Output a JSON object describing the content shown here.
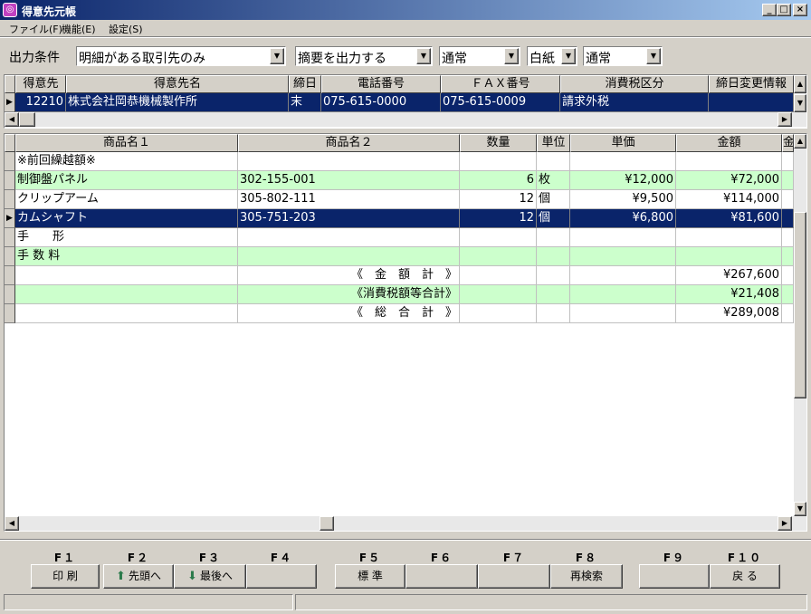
{
  "window": {
    "title": "得意先元帳",
    "icon_text": "◎",
    "minimize_label": "_",
    "maximize_label": "□",
    "close_label": "×"
  },
  "menu": {
    "items": [
      "ファイル(F)",
      "機能(E)",
      "設定(S)"
    ]
  },
  "options": {
    "label": "出力条件",
    "selects": [
      "明細がある取引先のみ",
      "摘要を出力する",
      "通常",
      "白紙",
      "通常"
    ]
  },
  "customer_grid": {
    "headers": [
      "得意先",
      "得意先名",
      "締日",
      "電話番号",
      "ＦＡＸ番号",
      "消費税区分",
      "締日変更情報"
    ],
    "row": [
      "12210",
      "株式会社岡恭機械製作所",
      "末",
      "075-615-0000",
      "075-615-0009",
      "請求外税",
      ""
    ]
  },
  "ledger_grid": {
    "headers": [
      "商品名１",
      "商品名２",
      "数量",
      "単位",
      "単価",
      "金額",
      "金"
    ],
    "rows": [
      [
        "※前回繰越額※",
        "",
        "",
        "",
        "",
        ""
      ],
      [
        "制御盤パネル",
        "302-155-001",
        "6",
        "枚",
        "¥12,000",
        "¥72,000"
      ],
      [
        "クリップアーム",
        "305-802-111",
        "12",
        "個",
        "¥9,500",
        "¥114,000"
      ],
      [
        "カムシャフト",
        "305-751-203",
        "12",
        "個",
        "¥6,800",
        "¥81,600"
      ],
      [
        "手　　形",
        "",
        "",
        "",
        "",
        ""
      ],
      [
        "手 数 料",
        "",
        "",
        "",
        "",
        ""
      ],
      [
        "",
        "《　金　額　計　》",
        "",
        "",
        "",
        "¥267,600"
      ],
      [
        "",
        "《消費税額等合計》",
        "",
        "",
        "",
        "¥21,408"
      ],
      [
        "",
        "《　総　合　計　》",
        "",
        "",
        "",
        "¥289,008"
      ]
    ],
    "selected_row": 3
  },
  "fkeys": [
    {
      "key": "F１",
      "label": "印 刷",
      "icon": ""
    },
    {
      "key": "F２",
      "label": "先頭へ",
      "icon": "up-arrow-icon"
    },
    {
      "key": "F３",
      "label": "最後へ",
      "icon": "down-arrow-icon"
    },
    {
      "key": "F４",
      "label": "",
      "icon": ""
    },
    {
      "key": "F５",
      "label": "標 準",
      "icon": ""
    },
    {
      "key": "F６",
      "label": "",
      "icon": ""
    },
    {
      "key": "F７",
      "label": "",
      "icon": ""
    },
    {
      "key": "F８",
      "label": "再検索",
      "icon": ""
    },
    {
      "key": "F９",
      "label": "",
      "icon": ""
    },
    {
      "key": "F１０",
      "label": "戻 る",
      "icon": ""
    }
  ],
  "colors": {
    "selected": "#0a246a",
    "green_row": "#ccffcc",
    "face": "#d4d0c8"
  }
}
